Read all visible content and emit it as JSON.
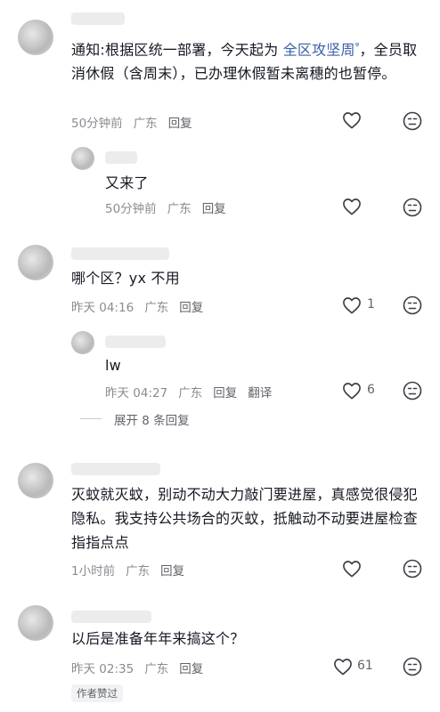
{
  "comments": [
    {
      "text_prefix": "通知:根据区统一部署，今天起为 ",
      "link": "全区攻坚周",
      "link_mark": "ᵠ",
      "text_suffix": "，全员取消休假（含周末），已办理休假暂未离穗的也暂停。",
      "time": "50分钟前",
      "location": "广东",
      "reply": "回复"
    },
    {
      "text": "又来了",
      "time": "50分钟前",
      "location": "广东",
      "reply": "回复"
    },
    {
      "text": "哪个区？yx 不用",
      "time": "昨天 04:16",
      "location": "广东",
      "reply": "回复",
      "likes": "1"
    },
    {
      "text": "lw",
      "time": "昨天 04:27",
      "location": "广东",
      "reply": "回复",
      "translate": "翻译",
      "likes": "6"
    },
    {
      "text": "灭蚊就灭蚊，别动不动大力敲门要进屋，真感觉很侵犯隐私。我支持公共场合的灭蚊，抵触动不动要进屋检查指指点点",
      "time": "1小时前",
      "location": "广东",
      "reply": "回复"
    },
    {
      "text": "以后是准备年年来搞这个？",
      "time": "昨天 02:35",
      "location": "广东",
      "reply": "回复",
      "likes": "61",
      "badge": "作者赞过"
    }
  ],
  "expand_replies": "展开 8 条回复",
  "icons": {
    "like": "heart-outline-icon",
    "dislike": "neutral-face-icon"
  },
  "colors": {
    "link": "#3b5fa8",
    "meta": "#8a8b91",
    "text": "#161823"
  }
}
